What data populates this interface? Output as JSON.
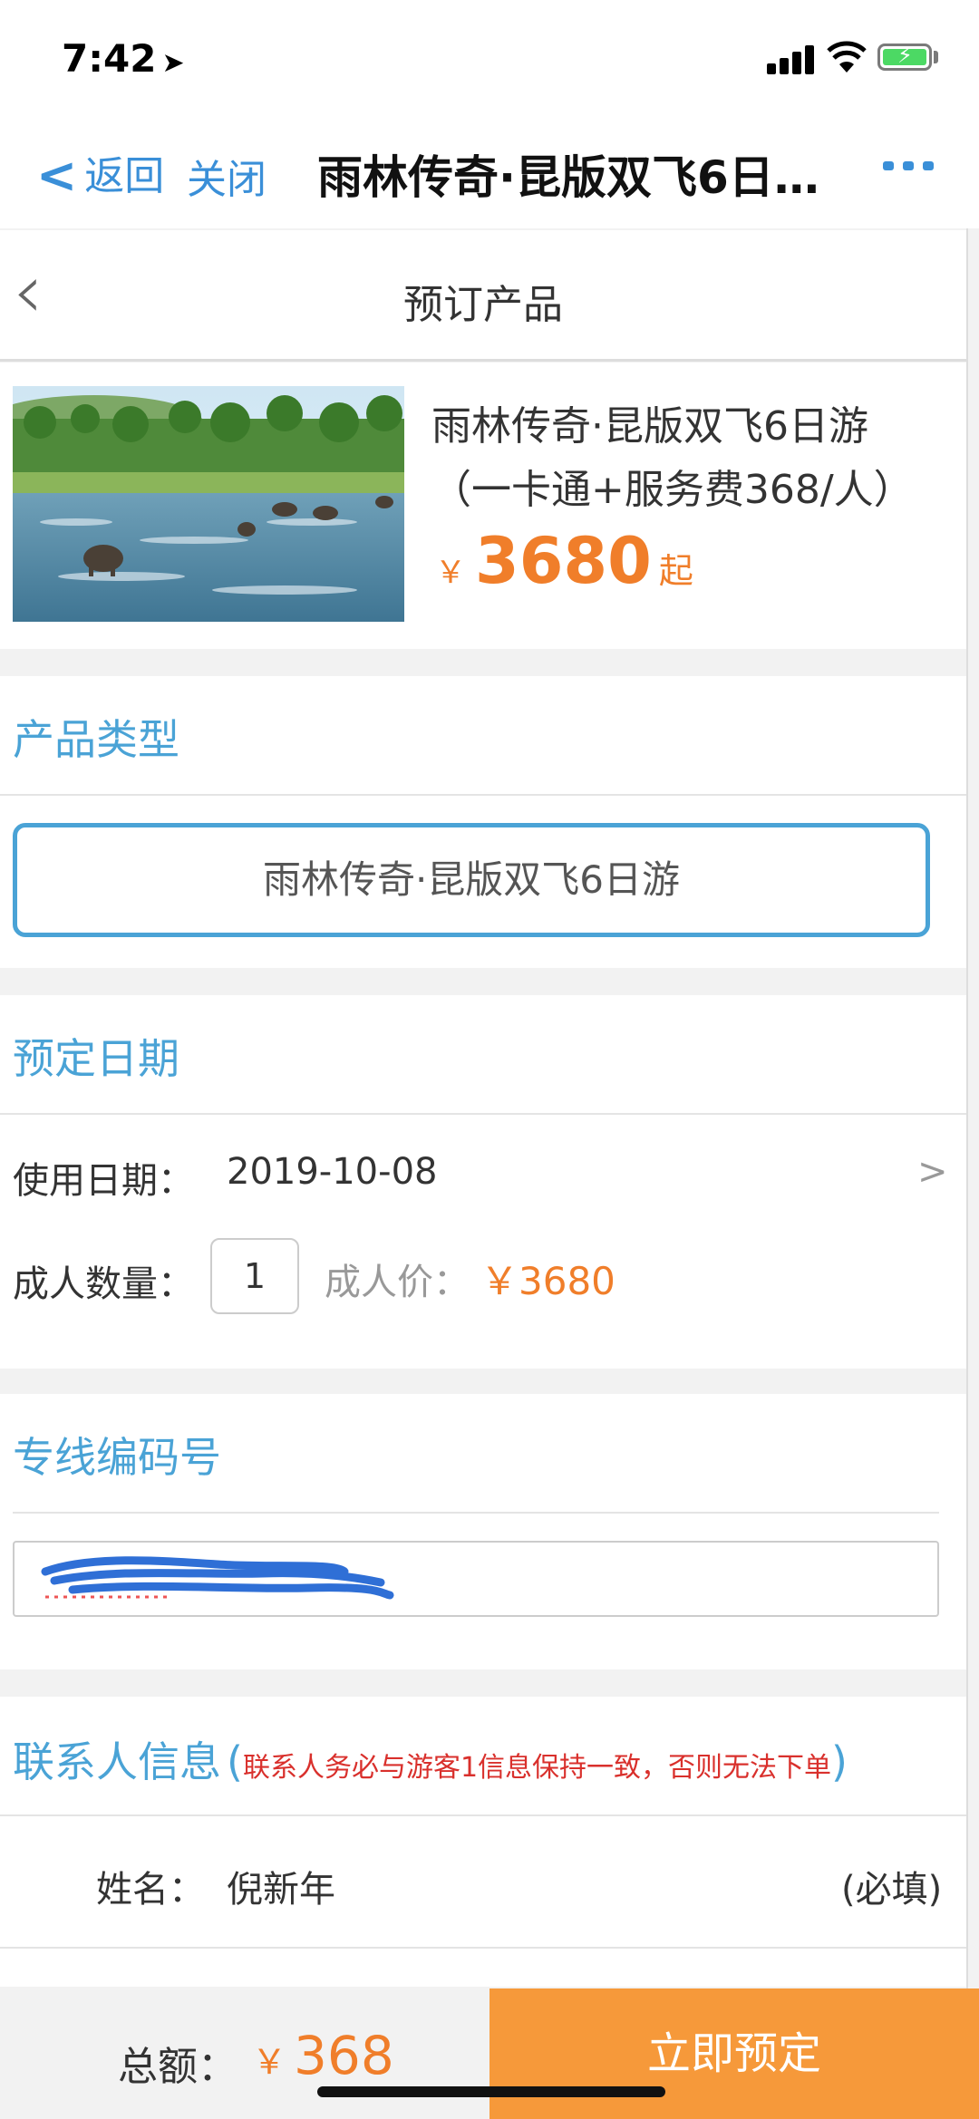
{
  "status_bar": {
    "time": "7:42",
    "location_arrow": "➤"
  },
  "nav": {
    "back_label": "返回",
    "close_label": "关闭",
    "title": "雨林传奇·昆版双飞6日…"
  },
  "sub_header": {
    "title": "预订产品"
  },
  "product": {
    "name_line1": "雨林传奇·昆版双飞6日游",
    "name_line2": "（一卡通+服务费368/人）",
    "currency": "￥",
    "price": "3680",
    "price_suffix": "起"
  },
  "product_type": {
    "section_title": "产品类型",
    "selected": "雨林传奇·昆版双飞6日游"
  },
  "booking_date": {
    "section_title": "预定日期",
    "use_date_label": "使用日期：",
    "use_date_value": "2019-10-08",
    "chevron": ">",
    "adult_qty_label": "成人数量：",
    "adult_qty": "1",
    "adult_price_label": "成人价：",
    "adult_price": "￥3680"
  },
  "line_code": {
    "section_title": "专线编码号"
  },
  "contact": {
    "section_title": "联系人信息",
    "paren_open": "(",
    "paren_close": ")",
    "warning": "联系人务必与游客1信息保持一致，否则无法下单",
    "name_label": "姓名：",
    "name_value": "倪新年",
    "required": "(必填)"
  },
  "footer": {
    "total_label": "总额：",
    "currency": "￥",
    "total_value": "368",
    "book_label": "立即预定"
  },
  "colors": {
    "accent_blue": "#4aa3d6",
    "price_orange": "#f07e2a",
    "book_button": "#f6993a",
    "warning_red": "#d9302c"
  }
}
